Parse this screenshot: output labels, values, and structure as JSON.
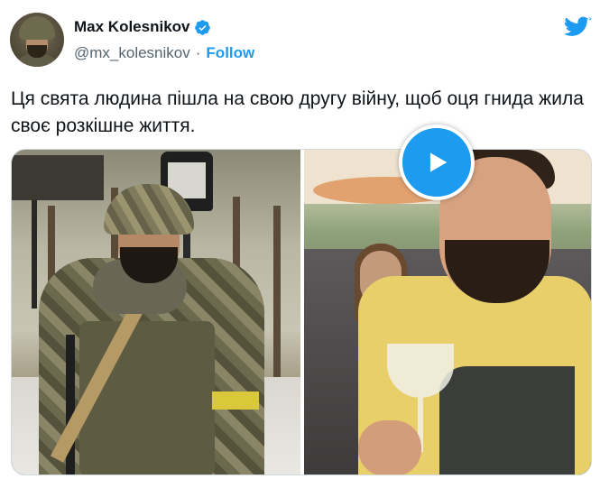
{
  "author": {
    "name": "Max Kolesnikov",
    "handle": "@mx_kolesnikov",
    "separator": "·",
    "follow_label": "Follow",
    "verified": true
  },
  "tweet": {
    "text": "Ця свята людина пішла на свою другу війну, щоб оця гнида жила своє розкішне життя."
  },
  "icons": {
    "verified": "verified-badge-icon",
    "brand": "twitter-bird-icon",
    "play": "play-icon"
  },
  "colors": {
    "accent": "#1d9bf0",
    "text": "#0f1419",
    "secondary": "#536471"
  }
}
